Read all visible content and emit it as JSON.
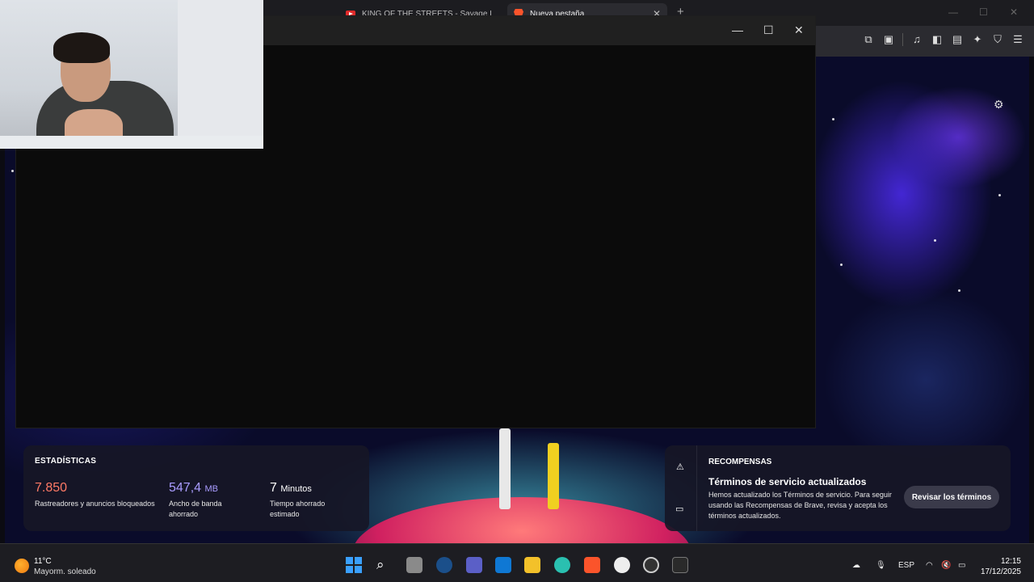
{
  "browser": {
    "tabs": [
      {
        "title": "KING OF THE STREETS - Savage KO's",
        "favicon": "youtube-icon",
        "active": false
      },
      {
        "title": "Nueva pestaña",
        "favicon": "brave-icon",
        "active": true
      }
    ],
    "toolbar_icons": [
      "extensions-icon",
      "screenshot-icon",
      "music-icon",
      "sidebar-icon",
      "wallet-icon",
      "leo-ai-icon",
      "shield-icon",
      "menu-icon"
    ]
  },
  "stats": {
    "title": "ESTADÍSTICAS",
    "trackers_value": "7.850",
    "trackers_label": "Rastreadores y anuncios bloqueados",
    "bandwidth_value": "547,4",
    "bandwidth_unit": "MB",
    "bandwidth_label": "Ancho de banda ahorrado",
    "time_value": "7",
    "time_unit": "Minutos",
    "time_label": "Tiempo ahorrado estimado",
    "colors": {
      "trackers": "#ff7a66",
      "bandwidth": "#a99cff",
      "time": "#ffffff"
    }
  },
  "rewards": {
    "title": "RECOMPENSAS",
    "heading": "Términos de servicio actualizados",
    "body": "Hemos actualizado los Términos de servicio. Para seguir usando las Recompensas de Brave, revisa y acepta los términos actualizados.",
    "button_label": "Revisar los términos"
  },
  "taskbar": {
    "weather_temp": "11°C",
    "weather_desc": "Mayorm. soleado",
    "language": "ESP",
    "time": "12:15",
    "date": "17/12/2025",
    "apps": [
      "windows-start-icon",
      "search-icon",
      "file-explorer-task-icon",
      "steam-icon",
      "teams-icon",
      "outlook-icon",
      "folder-icon",
      "bug-app-icon",
      "brave-browser-icon",
      "penguin-app-icon",
      "obs-icon",
      "terminal-icon"
    ]
  }
}
